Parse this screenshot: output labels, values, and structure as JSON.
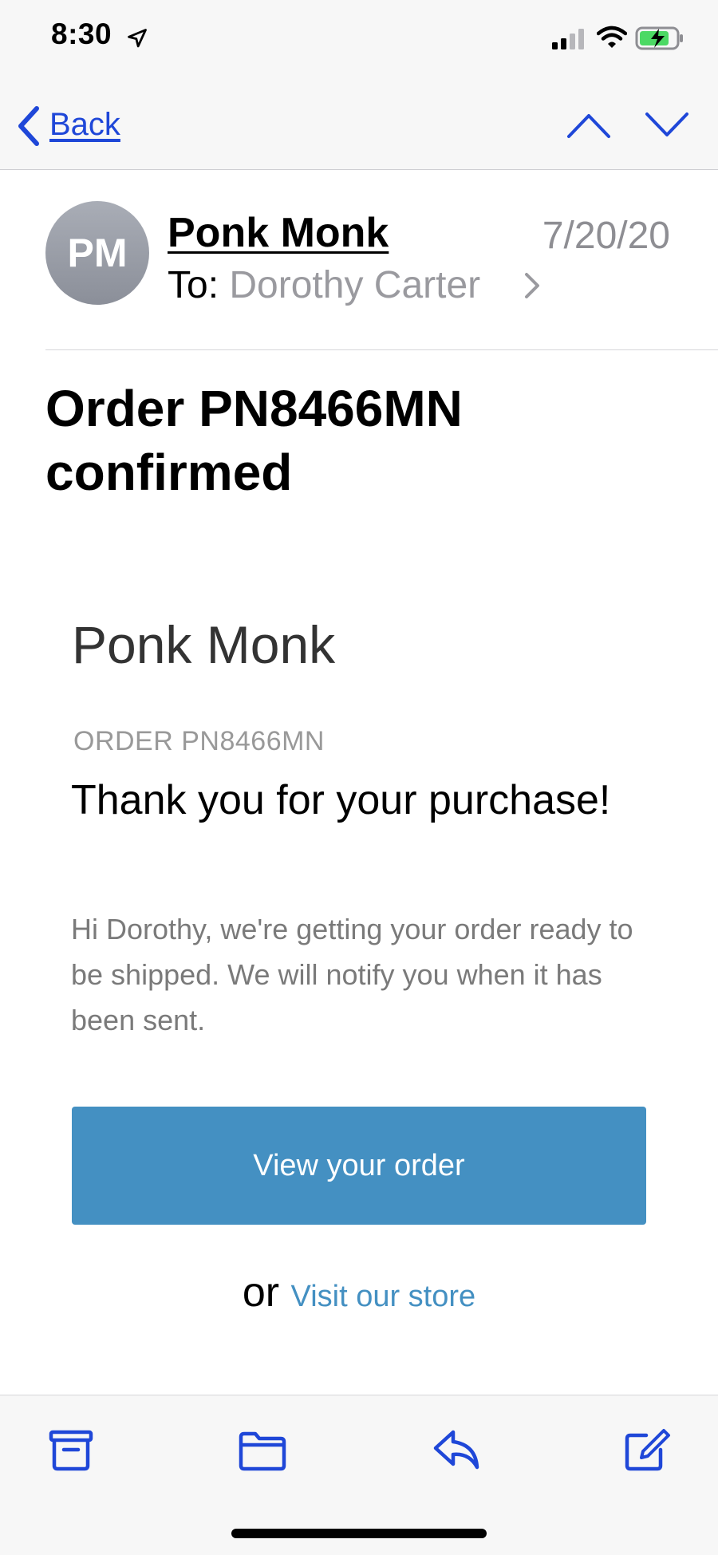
{
  "status_bar": {
    "time": "8:30",
    "icons": [
      "location-arrow-icon",
      "cellular-signal-icon",
      "wifi-icon",
      "battery-charging-icon"
    ]
  },
  "nav": {
    "back_label": "Back",
    "icons": [
      "chevron-left-icon",
      "chevron-up-icon",
      "chevron-down-icon"
    ]
  },
  "message": {
    "avatar_initials": "PM",
    "sender": "Ponk Monk",
    "date": "7/20/20",
    "to_label": "To:",
    "to_name": "Dorothy Carter",
    "subject": "Order PN8466MN confirmed"
  },
  "email_body": {
    "store_name": "Ponk Monk",
    "order_label": "ORDER PN8466MN",
    "thanks": "Thank you for your purchase!",
    "message": "Hi Dorothy, we're getting your order ready to be shipped. We will notify you when it has been sent.",
    "button_label": "View your order",
    "or_text": "or",
    "link_text": "Visit our store"
  },
  "toolbar": {
    "icons": [
      "archive-icon",
      "folder-icon",
      "reply-icon",
      "compose-icon"
    ]
  },
  "colors": {
    "ios_blue": "#1f47d8",
    "button_blue": "#4490c2",
    "secondary_gray": "#8e8e93"
  }
}
